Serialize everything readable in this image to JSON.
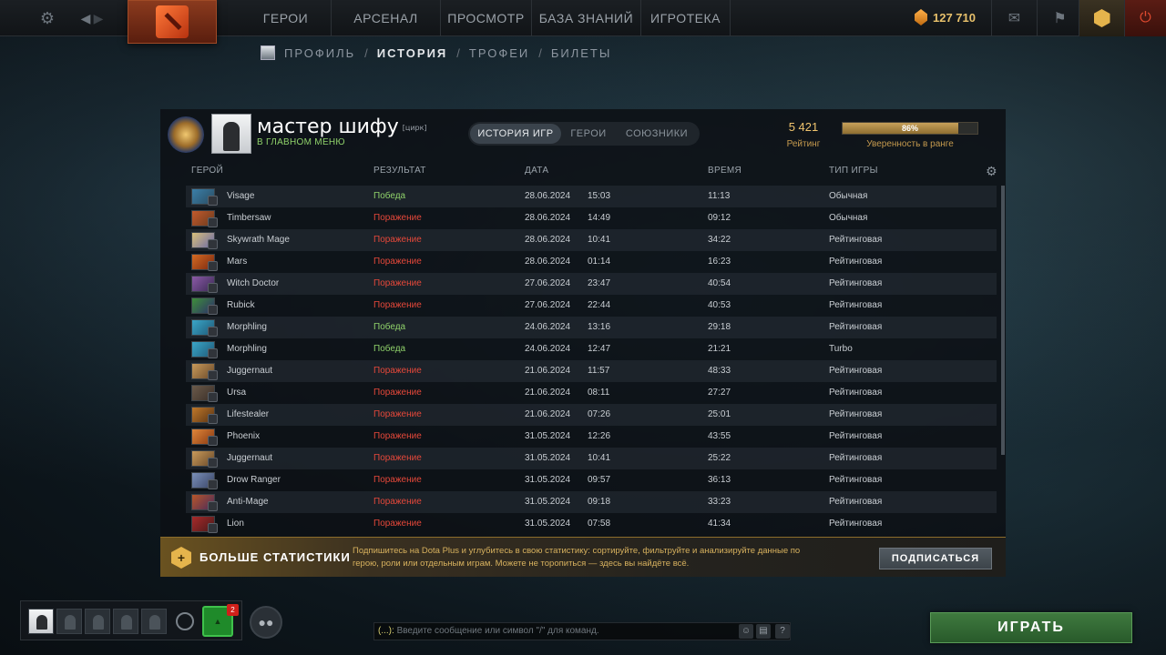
{
  "topbar": {
    "nav": [
      "ГЕРОИ",
      "АРСЕНАЛ",
      "ПРОСМОТР",
      "БАЗА ЗНАНИЙ",
      "ИГРОТЕКА"
    ],
    "shards": "127 710"
  },
  "subnav": {
    "items": [
      "ПРОФИЛЬ",
      "ИСТОРИЯ",
      "ТРОФЕИ",
      "БИЛЕТЫ"
    ],
    "separator": "/"
  },
  "profile": {
    "name": "мастер шифу",
    "tag": "[цирк]",
    "status": "В ГЛАВНОМ МЕНЮ",
    "rating": "5 421",
    "rating_label": "Рейтинг",
    "confidence": 0.86,
    "confidence_text": "86%",
    "confidence_label": "Уверенность в ранге"
  },
  "tabs": [
    "ИСТОРИЯ ИГР",
    "ГЕРОИ",
    "СОЮЗНИКИ"
  ],
  "columns": {
    "hero": "ГЕРОЙ",
    "result": "РЕЗУЛЬТАТ",
    "date": "ДАТА",
    "time": "ВРЕМЯ",
    "type": "ТИП ИГРЫ"
  },
  "matches": [
    {
      "hero": "Visage",
      "result": "Победа",
      "win": true,
      "date": "28.06.2024",
      "clock": "15:03",
      "duration": "11:13",
      "type": "Обычная",
      "c1": "#3b7fa8",
      "c2": "#2a4d63"
    },
    {
      "hero": "Timbersaw",
      "result": "Поражение",
      "win": false,
      "date": "28.06.2024",
      "clock": "14:49",
      "duration": "09:12",
      "type": "Обычная",
      "c1": "#c45a2c",
      "c2": "#6b3b1e"
    },
    {
      "hero": "Skywrath Mage",
      "result": "Поражение",
      "win": false,
      "date": "28.06.2024",
      "clock": "10:41",
      "duration": "34:22",
      "type": "Рейтинговая",
      "c1": "#d8c07a",
      "c2": "#6a6aa8"
    },
    {
      "hero": "Mars",
      "result": "Поражение",
      "win": false,
      "date": "28.06.2024",
      "clock": "01:14",
      "duration": "16:23",
      "type": "Рейтинговая",
      "c1": "#d56a22",
      "c2": "#7a2810"
    },
    {
      "hero": "Witch Doctor",
      "result": "Поражение",
      "win": false,
      "date": "27.06.2024",
      "clock": "23:47",
      "duration": "40:54",
      "type": "Рейтинговая",
      "c1": "#8b5aa6",
      "c2": "#3b2a55"
    },
    {
      "hero": "Rubick",
      "result": "Поражение",
      "win": false,
      "date": "27.06.2024",
      "clock": "22:44",
      "duration": "40:53",
      "type": "Рейтинговая",
      "c1": "#3e8f3a",
      "c2": "#2d2f6a"
    },
    {
      "hero": "Morphling",
      "result": "Победа",
      "win": true,
      "date": "24.06.2024",
      "clock": "13:16",
      "duration": "29:18",
      "type": "Рейтинговая",
      "c1": "#3aa6c8",
      "c2": "#1f5a78"
    },
    {
      "hero": "Morphling",
      "result": "Победа",
      "win": true,
      "date": "24.06.2024",
      "clock": "12:47",
      "duration": "21:21",
      "type": "Turbo",
      "c1": "#3aa6c8",
      "c2": "#1f5a78"
    },
    {
      "hero": "Juggernaut",
      "result": "Поражение",
      "win": false,
      "date": "21.06.2024",
      "clock": "11:57",
      "duration": "48:33",
      "type": "Рейтинговая",
      "c1": "#c99a5a",
      "c2": "#6a4a2a"
    },
    {
      "hero": "Ursa",
      "result": "Поражение",
      "win": false,
      "date": "21.06.2024",
      "clock": "08:11",
      "duration": "27:27",
      "type": "Рейтинговая",
      "c1": "#6b5a4a",
      "c2": "#3a2f28"
    },
    {
      "hero": "Lifestealer",
      "result": "Поражение",
      "win": false,
      "date": "21.06.2024",
      "clock": "07:26",
      "duration": "25:01",
      "type": "Рейтинговая",
      "c1": "#c0782a",
      "c2": "#5a3414"
    },
    {
      "hero": "Phoenix",
      "result": "Поражение",
      "win": false,
      "date": "31.05.2024",
      "clock": "12:26",
      "duration": "43:55",
      "type": "Рейтинговая",
      "c1": "#e0863a",
      "c2": "#8a3a12"
    },
    {
      "hero": "Juggernaut",
      "result": "Поражение",
      "win": false,
      "date": "31.05.2024",
      "clock": "10:41",
      "duration": "25:22",
      "type": "Рейтинговая",
      "c1": "#c99a5a",
      "c2": "#6a4a2a"
    },
    {
      "hero": "Drow Ranger",
      "result": "Поражение",
      "win": false,
      "date": "31.05.2024",
      "clock": "09:57",
      "duration": "36:13",
      "type": "Рейтинговая",
      "c1": "#7a8fb8",
      "c2": "#3a4668"
    },
    {
      "hero": "Anti-Mage",
      "result": "Поражение",
      "win": false,
      "date": "31.05.2024",
      "clock": "09:18",
      "duration": "33:23",
      "type": "Рейтинговая",
      "c1": "#b8562a",
      "c2": "#4a2a5a"
    },
    {
      "hero": "Lion",
      "result": "Поражение",
      "win": false,
      "date": "31.05.2024",
      "clock": "07:58",
      "duration": "41:34",
      "type": "Рейтинговая",
      "c1": "#a82a2a",
      "c2": "#4a1a1a"
    }
  ],
  "promo": {
    "title": "БОЛЬШЕ СТАТИСТИКИ",
    "text": "Подпишитесь на Dota Plus и углубитесь в свою статистику: сортируйте, фильтруйте и анализируйте данные по герою, роли или отдельным играм. Можете не торопиться — здесь вы найдёте всё.",
    "button": "ПОДПИСАТЬСЯ"
  },
  "guild_badge": "2",
  "chat": {
    "prefix": "(...):",
    "placeholder": "Введите сообщение или символ \"/\" для команд."
  },
  "play": "ИГРАТЬ",
  "colors": {
    "win": "#8fd16a",
    "loss": "#e5483a",
    "gold": "#f0c46e",
    "play": "#3f7a3f"
  }
}
